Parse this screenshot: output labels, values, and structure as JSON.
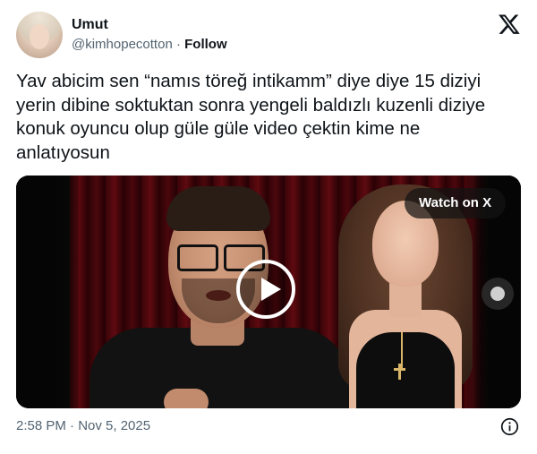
{
  "author": {
    "display_name": "Umut",
    "handle": "@kimhopecotton",
    "separator": " · ",
    "follow_label": "Follow",
    "avatar_icon": "profile-photo"
  },
  "brand": {
    "logo_icon": "x-logo-icon"
  },
  "tweet": {
    "text": "Yav abicim sen “namıs töreğ intikamm” diye diye 15 diziyi\nyerin dibine soktuktan sonra yengeli baldızlı kuzenli diziye\nkonuk oyuncu olup güle güle video çektin kime ne\nanlatıyosun"
  },
  "media": {
    "watch_label": "Watch on X",
    "play_icon": "play-icon"
  },
  "footer": {
    "timestamp": "2:58 PM · Nov 5, 2025",
    "info_icon": "info-icon"
  },
  "colors": {
    "text_primary": "#0f1419",
    "text_secondary": "#536471",
    "background": "#ffffff"
  }
}
